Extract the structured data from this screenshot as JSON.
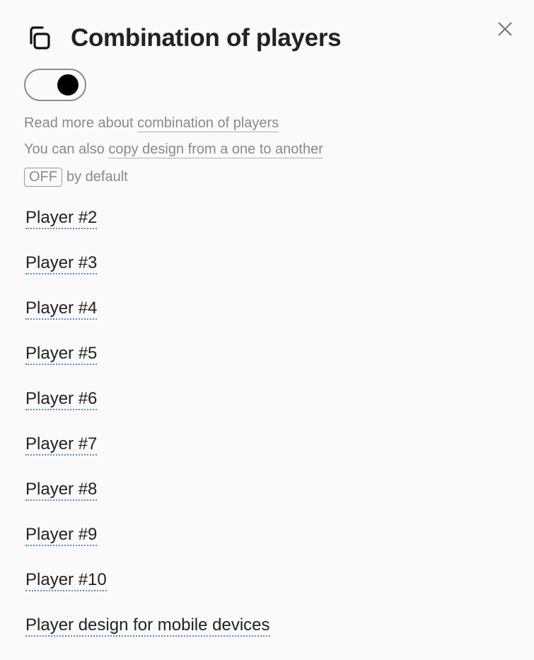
{
  "header": {
    "title": "Combination of players",
    "icon": "copy-icon",
    "close_icon": "close-icon"
  },
  "toggle": {
    "state": "on"
  },
  "info": {
    "line1_prefix": "Read more about ",
    "line1_link": "combination of players",
    "line2_prefix": "You can also ",
    "line2_link": "copy design from a one to another",
    "default_badge": "OFF",
    "default_suffix": "by default"
  },
  "players": [
    {
      "label": "Player #2"
    },
    {
      "label": "Player #3"
    },
    {
      "label": "Player #4"
    },
    {
      "label": "Player #5"
    },
    {
      "label": "Player #6"
    },
    {
      "label": "Player #7"
    },
    {
      "label": "Player #8"
    },
    {
      "label": "Player #9"
    },
    {
      "label": "Player #10"
    },
    {
      "label": "Player design for mobile devices"
    }
  ],
  "colors": {
    "link_underline": "#5b8bd6",
    "text": "#222222",
    "muted": "#8a8a8a"
  }
}
